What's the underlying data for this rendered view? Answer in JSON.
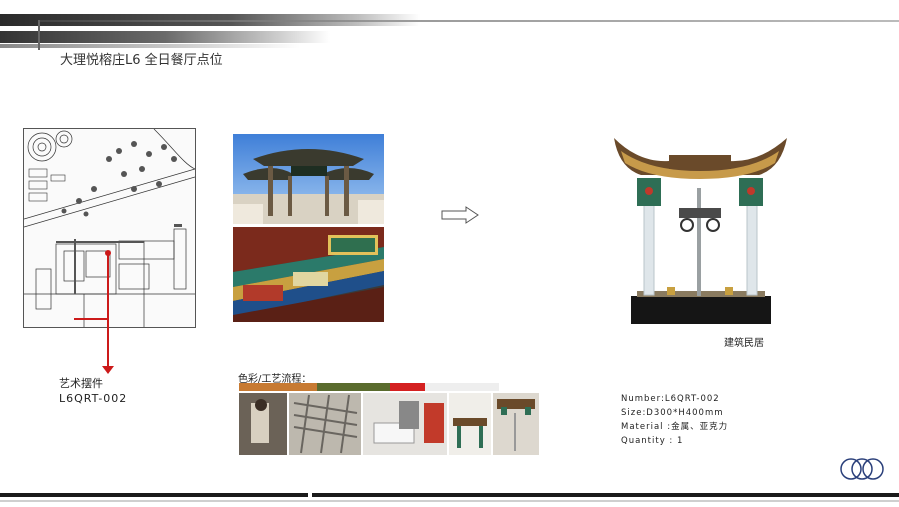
{
  "header": {
    "title": "大理悦榕庄L6 全日餐厅点位"
  },
  "plan": {
    "label": "艺术摆件",
    "code": "L6QRT-002"
  },
  "product": {
    "caption": "建筑民居"
  },
  "process": {
    "title": "色彩/工艺流程：",
    "swatches": [
      "#c77a32",
      "#5a6b2e",
      "#d42020",
      "#eeeeee"
    ]
  },
  "specs": {
    "number": "Number:L6QRT-002",
    "size": "Size:D300*H400mm",
    "material": "Material   :金属、亚克力",
    "quantity": "Quantity  : 1"
  },
  "colors": {
    "accent_red": "#cc1a1a",
    "text": "#222222"
  }
}
